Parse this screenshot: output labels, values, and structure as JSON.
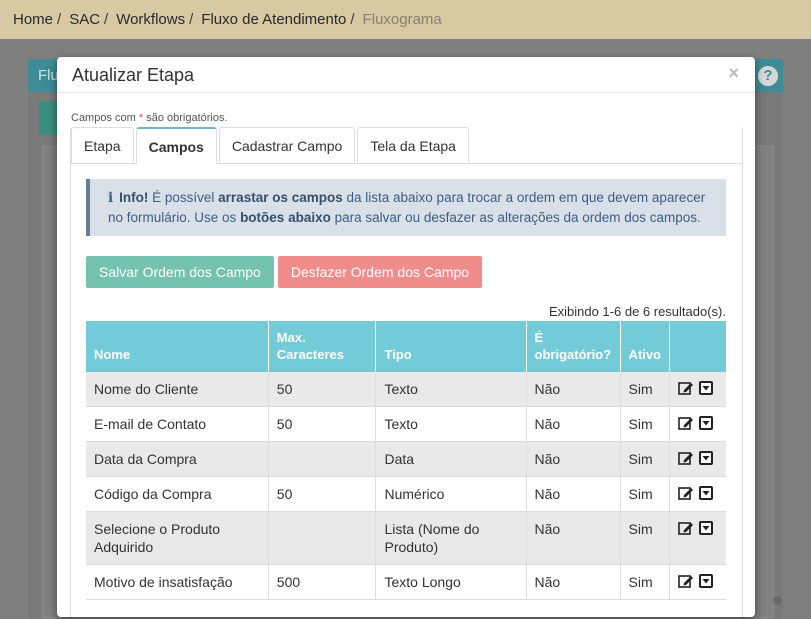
{
  "breadcrumb": {
    "items": [
      "Home",
      "SAC",
      "Workflows",
      "Fluxo de Atendimento"
    ],
    "active": "Fluxograma",
    "separator": "/"
  },
  "background": {
    "panel_title": "Flu",
    "help_icon": "question-circle-icon",
    "help_glyph": "?"
  },
  "modal": {
    "title": "Atualizar Etapa",
    "close_glyph": "×",
    "required_note_before": "Campos com ",
    "required_star": "*",
    "required_note_after": " são obrigatórios.",
    "tabs": [
      "Etapa",
      "Campos",
      "Cadastrar Campo",
      "Tela da Etapa"
    ],
    "active_tab": "Campos",
    "alert": {
      "icon": "info-icon",
      "icon_glyph": "i",
      "label": "Info!",
      "text1": " É possível ",
      "bold1": "arrastar os campos",
      "text2": " da lista abaixo para trocar a ordem em que devem aparecer no formulário. Use os ",
      "bold2": "botões abaixo",
      "text3": " para salvar ou desfazer as alterações da ordem dos campos."
    },
    "buttons": {
      "save": "Salvar Ordem dos Campo",
      "undo": "Desfazer Ordem dos Campo"
    },
    "summary": "Exibindo 1-6 de 6 resultado(s).",
    "table": {
      "headers": [
        "Nome",
        "Max. Caracteres",
        "Tipo",
        "É obrigatório?",
        "Ativo",
        ""
      ],
      "rows": [
        {
          "nome": "Nome do Cliente",
          "max": "50",
          "tipo": "Texto",
          "obrig": "Não",
          "ativo": "Sim"
        },
        {
          "nome": "E-mail de Contato",
          "max": "50",
          "tipo": "Texto",
          "obrig": "Não",
          "ativo": "Sim"
        },
        {
          "nome": "Data da Compra",
          "max": "",
          "tipo": "Data",
          "obrig": "Não",
          "ativo": "Sim"
        },
        {
          "nome": "Código da Compra",
          "max": "50",
          "tipo": "Numérico",
          "obrig": "Não",
          "ativo": "Sim"
        },
        {
          "nome": "Selecione o Produto Adquirido",
          "max": "",
          "tipo": "Lista (Nome do Produto)",
          "obrig": "Não",
          "ativo": "Sim"
        },
        {
          "nome": "Motivo de insatisfação",
          "max": "500",
          "tipo": "Texto Longo",
          "obrig": "Não",
          "ativo": "Sim"
        }
      ],
      "row_action_icons": [
        "edit-icon",
        "dropdown-icon"
      ]
    }
  },
  "colors": {
    "breadcrumb_bg": "#d6c9a3",
    "table_header": "#74cbd8",
    "save_button": "#75c2ae",
    "undo_button": "#ef8d8d",
    "alert_bg": "#d9e0e8"
  }
}
